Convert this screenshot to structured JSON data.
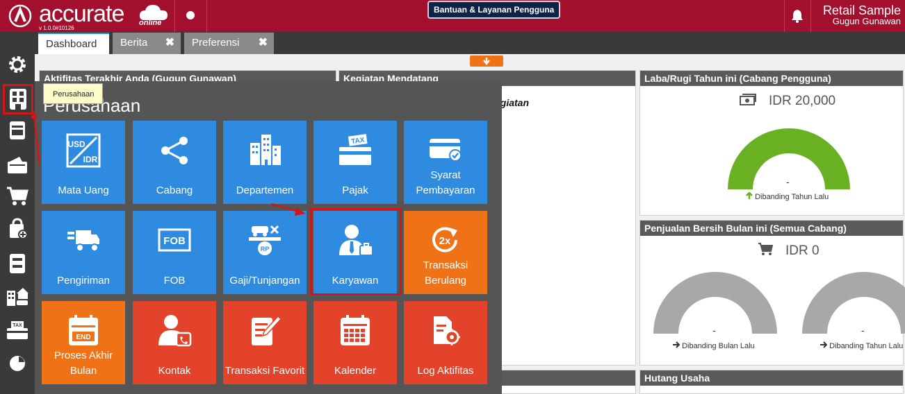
{
  "brand": {
    "name": "accurate",
    "online": "online",
    "version": "v 1.0.0#10126"
  },
  "header": {
    "help_label": "Bantuan & Layanan Pengguna",
    "company_name": "Retail Sample",
    "user_name": "Gugun Gunawan"
  },
  "tabs": [
    {
      "label": "Dashboard"
    },
    {
      "label": "Berita"
    },
    {
      "label": "Preferensi"
    }
  ],
  "tab_close_glyph": "✖",
  "sidebar": {
    "items": [
      "gear-icon",
      "building-icon",
      "book-icon",
      "wallet-icon",
      "cart-icon",
      "bag-icon",
      "archive-icon",
      "assets-icon",
      "tax-icon",
      "pie-chart-icon"
    ],
    "tooltip": "Perusahaan"
  },
  "panels": {
    "activity": {
      "title": "Aktifitas Terakhir Anda (Gugun Gunawan)"
    },
    "upcoming": {
      "title": "Kegiatan Mendatang",
      "partial_text": "egiatan"
    },
    "profit": {
      "title": "Laba/Rugi Tahun ini (Cabang Pengguna)",
      "amount": "IDR 20,000",
      "value": "-",
      "compare": "Dibanding Tahun Lalu",
      "gauge_color": "#6ab023"
    },
    "sales": {
      "title": "Penjualan Bersih Bulan ini (Semua Cabang)",
      "amount": "IDR 0",
      "left_value": "-",
      "left_compare": "Dibanding Bulan Lalu",
      "right_value": "-",
      "right_compare": "Dibanding Tahun Lalu",
      "gauge_color": "#a8a8a8"
    },
    "debt": {
      "title": "Hutang Usaha"
    }
  },
  "menu": {
    "title": "Perusahaan",
    "tiles": [
      {
        "label": "Mata Uang",
        "icon": "currency-icon",
        "color": "blue"
      },
      {
        "label": "Cabang",
        "icon": "share-icon",
        "color": "blue"
      },
      {
        "label": "Departemen",
        "icon": "buildings-icon",
        "color": "blue"
      },
      {
        "label": "Pajak",
        "icon": "tax-card-icon",
        "color": "blue"
      },
      {
        "label": "Syarat Pembayaran",
        "icon": "card-check-icon",
        "color": "blue"
      },
      {
        "label": "Pengiriman",
        "icon": "truck-icon",
        "color": "blue"
      },
      {
        "label": "FOB",
        "icon": "fob-icon",
        "color": "blue"
      },
      {
        "label": "Gaji/Tunjangan",
        "icon": "payroll-icon",
        "color": "blue"
      },
      {
        "label": "Karyawan",
        "icon": "employee-icon",
        "color": "blue"
      },
      {
        "label": "Transaksi Berulang",
        "icon": "repeat-2x-icon",
        "color": "orange"
      },
      {
        "label": "Proses Akhir Bulan",
        "icon": "calendar-end-icon",
        "color": "orange"
      },
      {
        "label": "Kontak",
        "icon": "contact-icon",
        "color": "red"
      },
      {
        "label": "Transaksi Favorit",
        "icon": "favorite-doc-icon",
        "color": "red"
      },
      {
        "label": "Kalender",
        "icon": "calendar-icon",
        "color": "red"
      },
      {
        "label": "Log Aktifitas",
        "icon": "log-icon",
        "color": "red"
      }
    ]
  },
  "icon_text": {
    "usd": "USD",
    "idr": "IDR",
    "tax": "TAX",
    "fob": "FOB",
    "rp": "RP",
    "twox": "2x",
    "end": "END"
  },
  "colors": {
    "topbar": "#a2102d",
    "blue_tile": "#2f8be0",
    "orange_tile": "#f07216",
    "red_tile": "#e3432a",
    "highlight": "#d0151b"
  }
}
